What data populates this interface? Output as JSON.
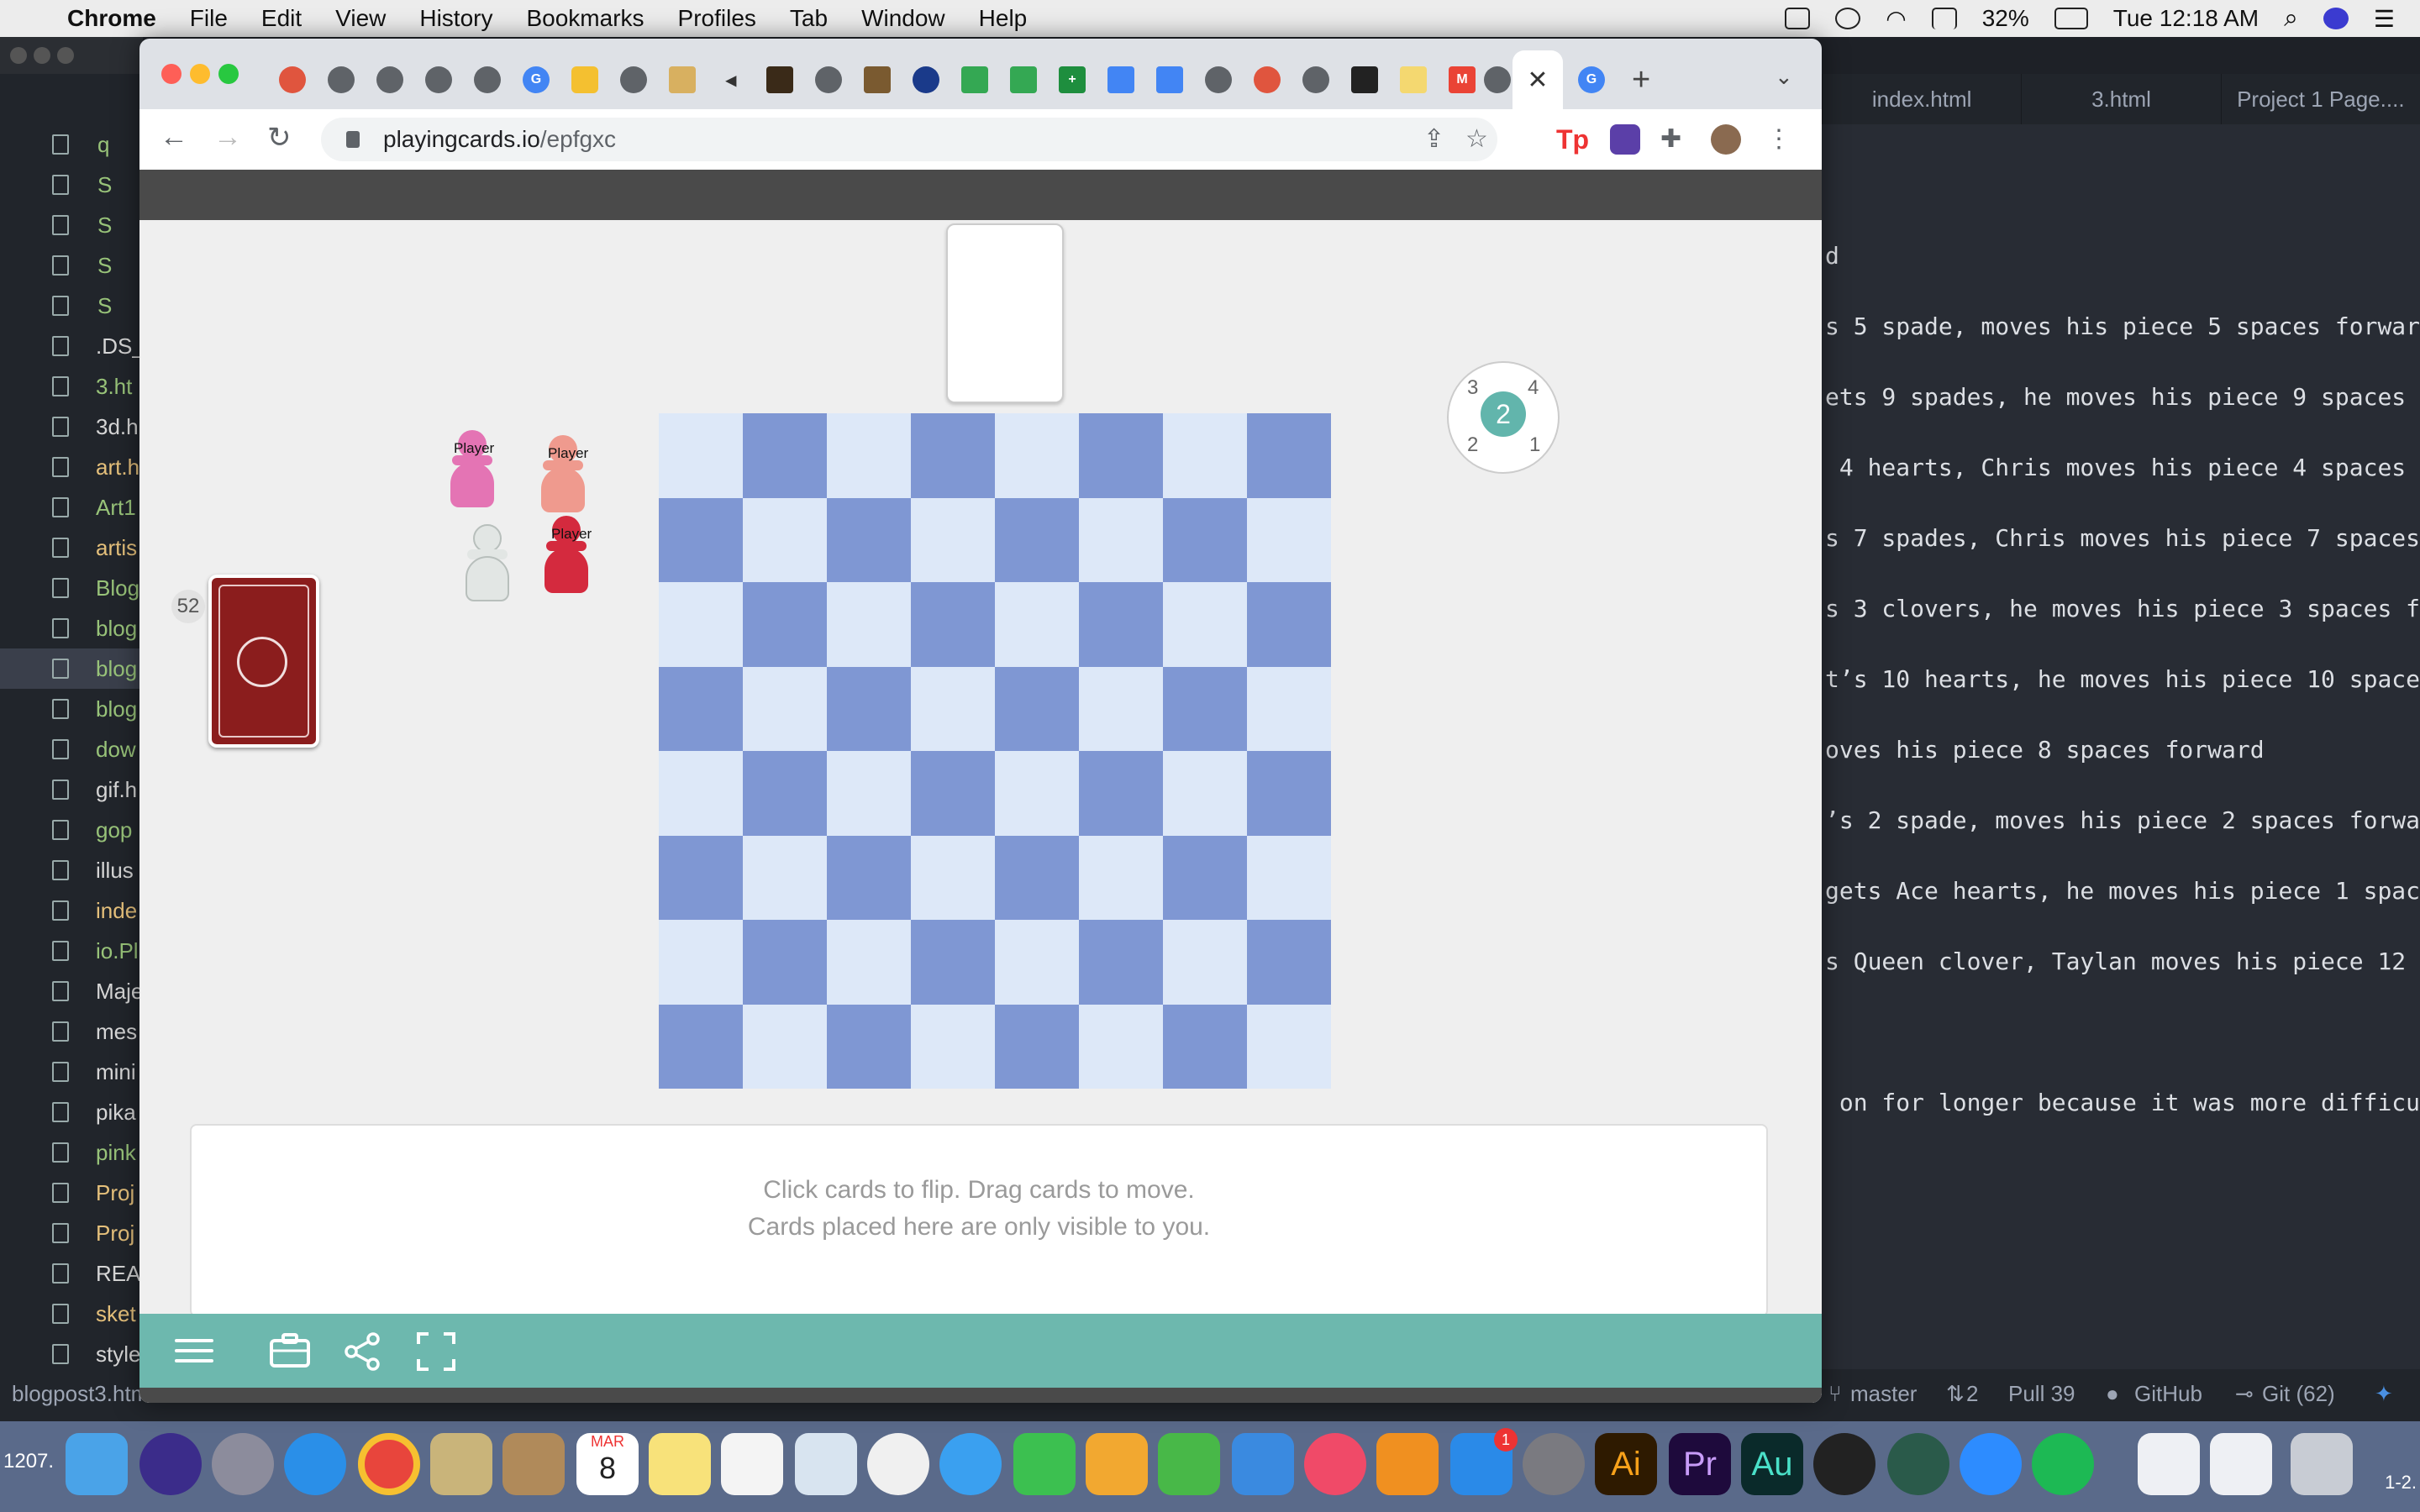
{
  "menubar": {
    "app": "Chrome",
    "items": [
      "File",
      "Edit",
      "View",
      "History",
      "Bookmarks",
      "Profiles",
      "Tab",
      "Window",
      "Help"
    ],
    "battery": "32%",
    "clock": "Tue 12:18 AM"
  },
  "browser": {
    "url_host": "playingcards.io",
    "url_path": "/epfgxc",
    "close_label": "✕",
    "new_tab": "+"
  },
  "game": {
    "pawn_label": "Player",
    "deck_count": "52",
    "dial": {
      "value": "2",
      "n1": "1",
      "n2": "2",
      "n3": "3",
      "n4": "4"
    },
    "hand_hint_line1": "Click cards to flip.   Drag cards to move.",
    "hand_hint_line2": "Cards placed here are only visible to you."
  },
  "editor": {
    "tabs": [
      "index.html",
      "3.html",
      "Project 1 Page...."
    ],
    "sidebar_files": [
      {
        "name": "q",
        "color": "green"
      },
      {
        "name": "S",
        "color": "green"
      },
      {
        "name": "S",
        "color": "green"
      },
      {
        "name": "S",
        "color": "green"
      },
      {
        "name": "S",
        "color": "green"
      },
      {
        "name": ".DS_",
        "color": "plain"
      },
      {
        "name": "3.ht",
        "color": "green"
      },
      {
        "name": "3d.h",
        "color": "plain"
      },
      {
        "name": "art.h",
        "color": "yellow"
      },
      {
        "name": "Art1",
        "color": "green"
      },
      {
        "name": "artis",
        "color": "yellow"
      },
      {
        "name": "Blog",
        "color": "green"
      },
      {
        "name": "blog",
        "color": "green"
      },
      {
        "name": "blog",
        "color": "green"
      },
      {
        "name": "blog",
        "color": "green"
      },
      {
        "name": "dow",
        "color": "green"
      },
      {
        "name": "gif.h",
        "color": "plain"
      },
      {
        "name": "gop",
        "color": "green"
      },
      {
        "name": "illus",
        "color": "plain"
      },
      {
        "name": "inde",
        "color": "yellow"
      },
      {
        "name": "io.Pl",
        "color": "green"
      },
      {
        "name": "Maje",
        "color": "plain"
      },
      {
        "name": "mes",
        "color": "plain"
      },
      {
        "name": "mini",
        "color": "plain"
      },
      {
        "name": "pika",
        "color": "plain"
      },
      {
        "name": "pink",
        "color": "green"
      },
      {
        "name": "Proj",
        "color": "yellow"
      },
      {
        "name": "Proj",
        "color": "yellow"
      },
      {
        "name": "REA",
        "color": "plain"
      },
      {
        "name": "sket",
        "color": "yellow"
      },
      {
        "name": "style",
        "color": "plain"
      }
    ],
    "code_lines": [
      "d",
      "s 5 spade, moves his piece 5 spaces forwar",
      "ets 9 spades, he moves his piece 9 spaces",
      " 4 hearts, Chris moves his piece 4 spaces",
      "s 7 spades, Chris moves his piece 7 spaces",
      "s 3 clovers, he moves his piece 3 spaces f",
      "t’s 10 hearts, he moves his piece 10 space",
      "oves his piece 8 spaces forward",
      "’s 2 spade, moves his piece 2 spaces forwa",
      "gets Ace hearts, he moves his piece 1 spac",
      "s Queen clover, Taylan moves his piece 12",
      " on for longer because it was more difficu"
    ],
    "status_file": "blogpost3.htm",
    "status_branch": "master",
    "status_sync": "2",
    "status_pull": "Pull 39",
    "status_github": "GitHub",
    "status_git": "Git (62)"
  },
  "dock": {
    "left_label": "1207.",
    "right_label": "1-2.",
    "calendar_month": "MAR",
    "calendar_day": "8",
    "appstore_badge": "1"
  },
  "colors": {
    "board_light": "#dde8f8",
    "board_dark": "#7f97d3",
    "accent_teal": "#6db8ae",
    "deck_red": "#8b1d1d"
  }
}
